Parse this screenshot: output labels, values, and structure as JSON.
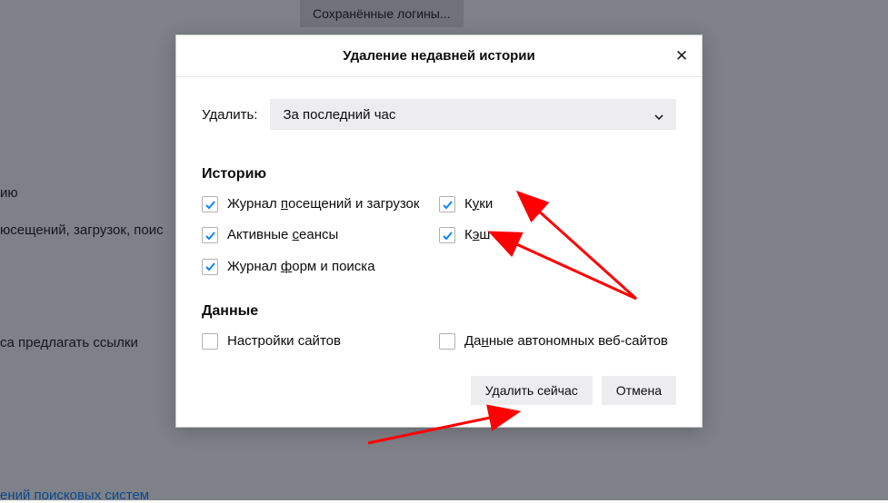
{
  "background": {
    "savedLoginsBtn": "Сохранённые логины...",
    "text1": "ию",
    "text2": "юсещений, загрузок, поис",
    "text3": "са предлагать ссылки",
    "link1": "ений поисковых систем"
  },
  "dialog": {
    "title": "Удаление недавней истории",
    "rangeLabel": "Удалить:",
    "rangeValue": "За последний час",
    "sections": {
      "history": {
        "heading": "Историю",
        "items": {
          "browsing": {
            "pre": "Журнал ",
            "u": "п",
            "post": "осещений и загрузок"
          },
          "cookies": {
            "pre": "К",
            "u": "у",
            "post": "ки"
          },
          "sessions": {
            "pre": "Активные ",
            "u": "с",
            "post": "еансы"
          },
          "cache": {
            "pre": "К",
            "u": "э",
            "post": "ш"
          },
          "forms": {
            "pre": "Журнал ",
            "u": "ф",
            "post": "орм и поиска"
          }
        }
      },
      "data": {
        "heading": "Данные",
        "items": {
          "siteSettings": {
            "pre": "Настройки сайтов",
            "u": "",
            "post": ""
          },
          "offline": {
            "pre": "Да",
            "u": "н",
            "post": "ные автономных веб-сайтов"
          }
        }
      }
    },
    "buttons": {
      "clearNow": "Удалить сейчас",
      "cancel": "Отмена"
    }
  }
}
